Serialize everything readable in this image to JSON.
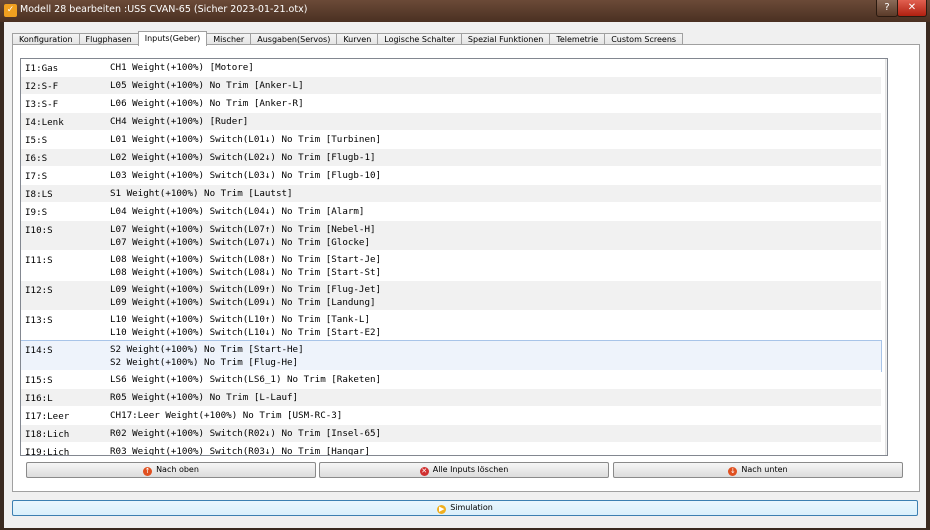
{
  "window": {
    "title": "Modell 28 bearbeiten :USS CVAN-65  (Sicher 2023-01-21.otx)",
    "help_label": "?",
    "close_label": "✕"
  },
  "tabs": [
    {
      "label": "Konfiguration"
    },
    {
      "label": "Flugphasen"
    },
    {
      "label": "Inputs(Geber)"
    },
    {
      "label": "Mischer"
    },
    {
      "label": "Ausgaben(Servos)"
    },
    {
      "label": "Kurven"
    },
    {
      "label": "Logische Schalter"
    },
    {
      "label": "Spezial Funktionen"
    },
    {
      "label": "Telemetrie"
    },
    {
      "label": "Custom Screens"
    }
  ],
  "active_tab": "Inputs(Geber)",
  "inputs": [
    {
      "name": "I1:Gas",
      "lines": [
        "CH1 Weight(+100%) [Motore]"
      ]
    },
    {
      "name": "I2:S-F",
      "lines": [
        "L05 Weight(+100%) No Trim [Anker-L]"
      ]
    },
    {
      "name": "I3:S-F",
      "lines": [
        "L06 Weight(+100%) No Trim [Anker-R]"
      ]
    },
    {
      "name": "I4:Lenk",
      "lines": [
        "CH4 Weight(+100%) [Ruder]"
      ]
    },
    {
      "name": "I5:S",
      "lines": [
        "L01 Weight(+100%) Switch(L01↓) No Trim [Turbinen]"
      ]
    },
    {
      "name": "I6:S",
      "lines": [
        "L02 Weight(+100%) Switch(L02↓) No Trim [Flugb-1]"
      ]
    },
    {
      "name": "I7:S",
      "lines": [
        "L03 Weight(+100%) Switch(L03↓) No Trim [Flugb-10]"
      ]
    },
    {
      "name": "I8:LS",
      "lines": [
        "S1 Weight(+100%) No Trim [Lautst]"
      ]
    },
    {
      "name": "I9:S",
      "lines": [
        "L04 Weight(+100%) Switch(L04↓) No Trim [Alarm]"
      ]
    },
    {
      "name": "I10:S",
      "lines": [
        "L07 Weight(+100%) Switch(L07↑) No Trim [Nebel-H]",
        "L07 Weight(+100%) Switch(L07↓) No Trim [Glocke]"
      ]
    },
    {
      "name": "I11:S",
      "lines": [
        "L08 Weight(+100%) Switch(L08↑) No Trim [Start-Je]",
        "L08 Weight(+100%) Switch(L08↓) No Trim [Start-St]"
      ]
    },
    {
      "name": "I12:S",
      "lines": [
        "L09 Weight(+100%) Switch(L09↑) No Trim [Flug-Jet]",
        "L09 Weight(+100%) Switch(L09↓) No Trim [Landung]"
      ]
    },
    {
      "name": "I13:S",
      "lines": [
        "L10 Weight(+100%) Switch(L10↑) No Trim [Tank-L]",
        "L10 Weight(+100%) Switch(L10↓) No Trim [Start-E2]"
      ]
    },
    {
      "name": "I14:S",
      "lines": [
        "S2 Weight(+100%) No Trim [Start-He]",
        "S2 Weight(+100%) No Trim [Flug-He]"
      ]
    },
    {
      "name": "I15:S",
      "lines": [
        "LS6 Weight(+100%) Switch(LS6_1) No Trim [Raketen]"
      ]
    },
    {
      "name": "I16:L",
      "lines": [
        "R05 Weight(+100%) No Trim [L-Lauf]"
      ]
    },
    {
      "name": "I17:Leer",
      "lines": [
        "CH17:Leer Weight(+100%) No Trim [USM-RC-3]"
      ]
    },
    {
      "name": "I18:Lich",
      "lines": [
        "R02 Weight(+100%) Switch(R02↓) No Trim [Insel-65]"
      ]
    },
    {
      "name": "I19:Lich",
      "lines": [
        "R03 Weight(+100%) Switch(R03↓) No Trim [Hangar]"
      ]
    }
  ],
  "selected_row": "I14:S",
  "buttons": {
    "move_up": "Nach oben",
    "clear_all": "Alle Inputs löschen",
    "move_down": "Nach unten",
    "simulation": "Simulation"
  },
  "icons": {
    "app": "companion-icon",
    "move_up": "arrow-up-icon",
    "clear_all": "delete-icon",
    "move_down": "arrow-down-icon",
    "simulation": "play-icon"
  }
}
